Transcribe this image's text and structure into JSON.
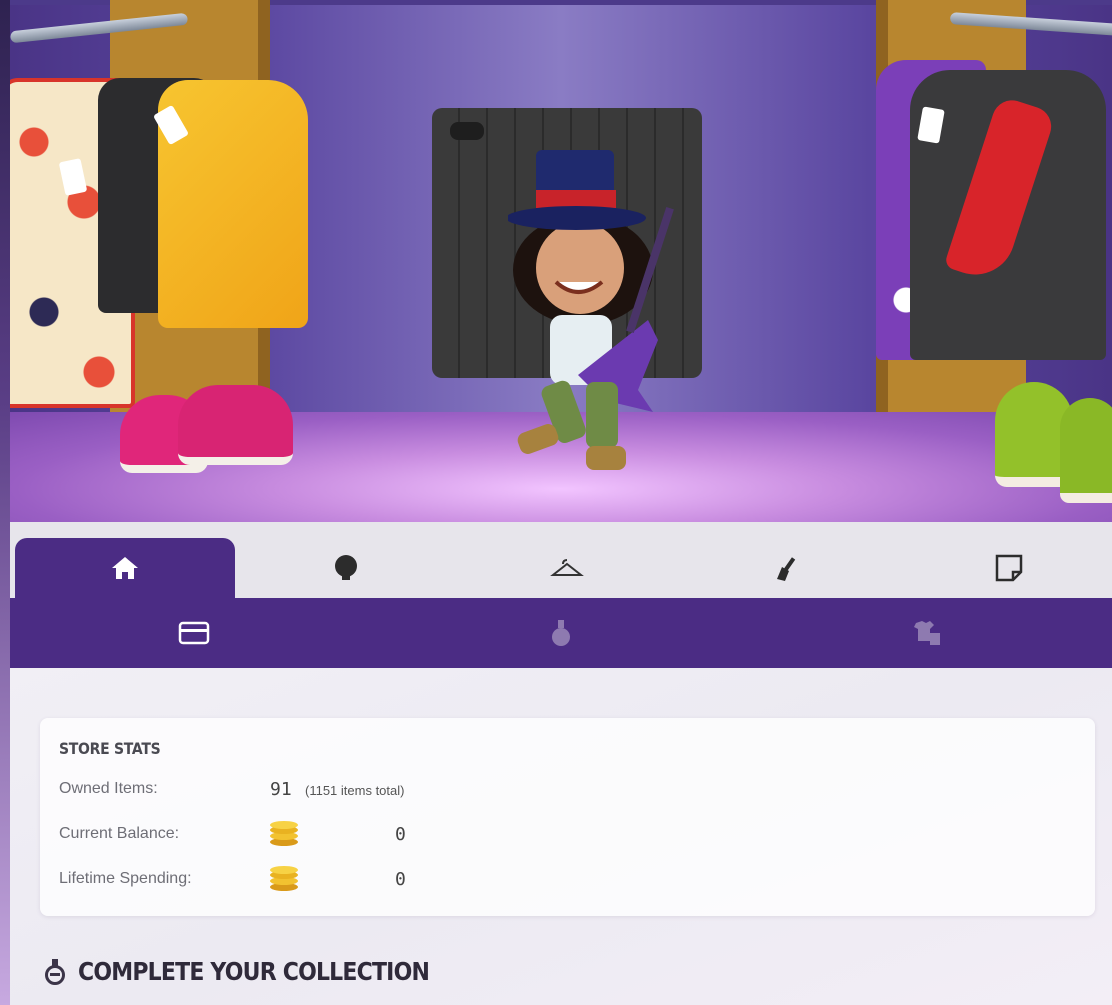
{
  "tabs": [
    {
      "id": "home",
      "icon": "home-icon",
      "active": true
    },
    {
      "id": "hair",
      "icon": "head-icon",
      "active": false
    },
    {
      "id": "clothes",
      "icon": "hanger-icon",
      "active": false
    },
    {
      "id": "guitar",
      "icon": "guitar-icon",
      "active": false
    },
    {
      "id": "note",
      "icon": "note-icon",
      "active": false
    }
  ],
  "subtabs": [
    {
      "id": "store",
      "icon": "card-icon",
      "active": true
    },
    {
      "id": "potion",
      "icon": "potion-icon",
      "active": false
    },
    {
      "id": "outfits",
      "icon": "outfits-icon",
      "active": false
    }
  ],
  "stats": {
    "title": "STORE STATS",
    "owned_label": "Owned Items:",
    "owned_value": "91",
    "owned_total": "(1151 items total)",
    "balance_label": "Current Balance:",
    "balance_value": "0",
    "spending_label": "Lifetime Spending:",
    "spending_value": "0"
  },
  "collection": {
    "title": "COMPLETE YOUR COLLECTION",
    "icon": "potion-icon"
  },
  "colors": {
    "tab_active": "#4b2c84",
    "tab_bar": "#e7e5eb",
    "coin": "#f2c230"
  }
}
